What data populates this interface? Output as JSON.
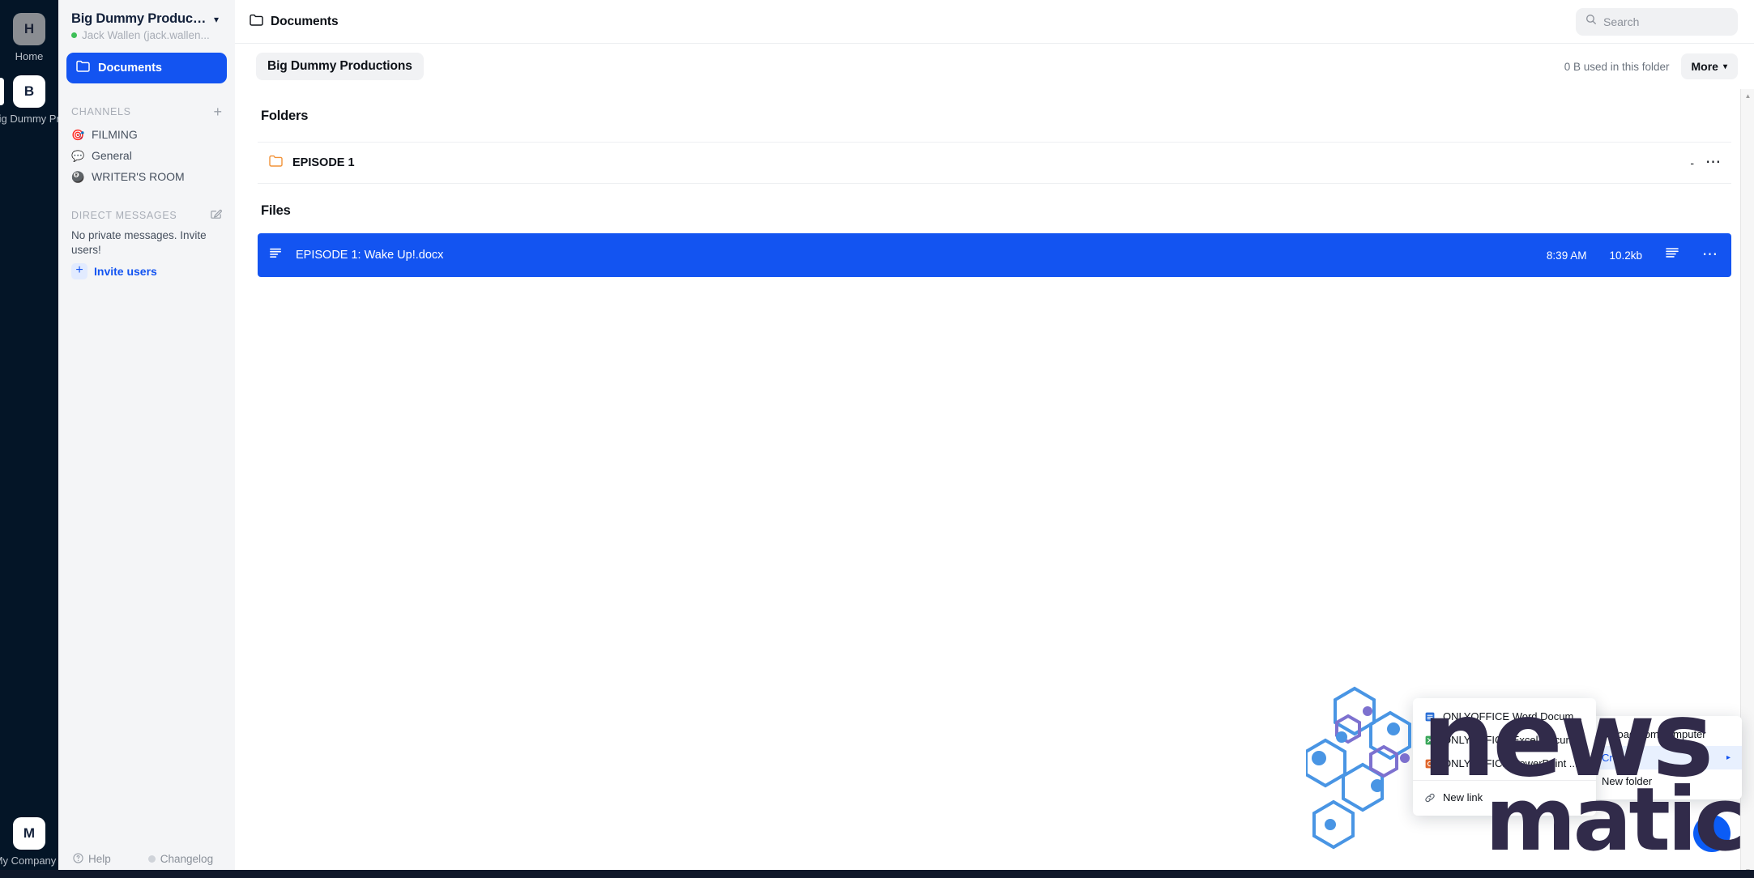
{
  "rail": {
    "items": [
      {
        "initial": "H",
        "label": "Home",
        "variant": "grey"
      },
      {
        "initial": "B",
        "label": "Big Dummy Productions",
        "variant": "white"
      }
    ],
    "bottom": {
      "initial": "M",
      "label": "My Company",
      "variant": "white"
    }
  },
  "sidebar": {
    "workspace_title": "Big Dummy Producti...",
    "user_name": "Jack Wallen (jack.wallen...",
    "nav": {
      "documents_label": "Documents",
      "folder_icon": "folder-icon"
    },
    "channels": {
      "section_label": "CHANNELS",
      "add_icon": "plus-icon",
      "items": [
        {
          "emoji": "🎯",
          "icon_name": "dart-emoji-icon",
          "label": "FILMING"
        },
        {
          "emoji": "💬",
          "icon_name": "speech-balloon-emoji-icon",
          "label": "General"
        },
        {
          "emoji": "🎱",
          "icon_name": "eight-ball-emoji-icon",
          "label": "WRITER'S ROOM"
        }
      ]
    },
    "direct_messages": {
      "section_label": "DIRECT MESSAGES",
      "compose_icon": "compose-icon",
      "empty_text": "No private messages. Invite users!",
      "invite_label": "Invite users"
    },
    "footer": {
      "help_label": "Help",
      "changelog_label": "Changelog"
    }
  },
  "topbar": {
    "breadcrumb_label": "Documents",
    "breadcrumb_icon": "folder-icon",
    "search": {
      "icon": "search-icon",
      "placeholder": "Search",
      "value": ""
    }
  },
  "titlebar": {
    "folder_title": "Big Dummy Productions",
    "storage_used": "0 B used in this folder",
    "more_label": "More",
    "more_chevron": "chevron-down-icon"
  },
  "content": {
    "folders_label": "Folders",
    "files_label": "Files",
    "folders": [
      {
        "name": "EPISODE 1",
        "icon": "folder-icon",
        "size": "-",
        "menu_icon": "ellipsis-icon"
      }
    ],
    "files": [
      {
        "name": "EPISODE 1: Wake Up!.docx",
        "icon": "document-icon",
        "time": "8:39 AM",
        "size": "10.2kb",
        "type_icon": "document-lines-icon",
        "menu_icon": "ellipsis-icon",
        "selected": true
      }
    ]
  },
  "scrollbar": {
    "up_icon": "chevron-up-icon",
    "down_icon": "chevron-down-icon"
  },
  "context_menu_create": {
    "items": [
      {
        "label": "ONLYOFFICE Word Docum...",
        "icon": "word-doc-icon"
      },
      {
        "label": "ONLYOFFICE Excel Docum...",
        "icon": "excel-doc-icon"
      },
      {
        "label": "ONLYOFFICE PowerPoint ...",
        "icon": "powerpoint-doc-icon"
      },
      {
        "label": "New link",
        "icon": "link-icon"
      }
    ]
  },
  "context_menu_more": {
    "items": [
      {
        "label": "Upload from computer",
        "icon": "upload-icon",
        "highlighted": false
      },
      {
        "label": "Create",
        "icon": "plus-icon",
        "highlighted": true,
        "chevron": "chevron-right-icon"
      },
      {
        "label": "New folder",
        "icon": "new-folder-icon",
        "highlighted": false
      }
    ]
  },
  "fab": {
    "icon": "chat-bubble-icon"
  },
  "watermark": {
    "line1": "news",
    "line2": "matic"
  },
  "colors": {
    "accent_blue": "#1354f1",
    "rail_dark": "#041527",
    "sidebar_bg": "#f4f5f7",
    "folder_orange": "#f29339"
  }
}
